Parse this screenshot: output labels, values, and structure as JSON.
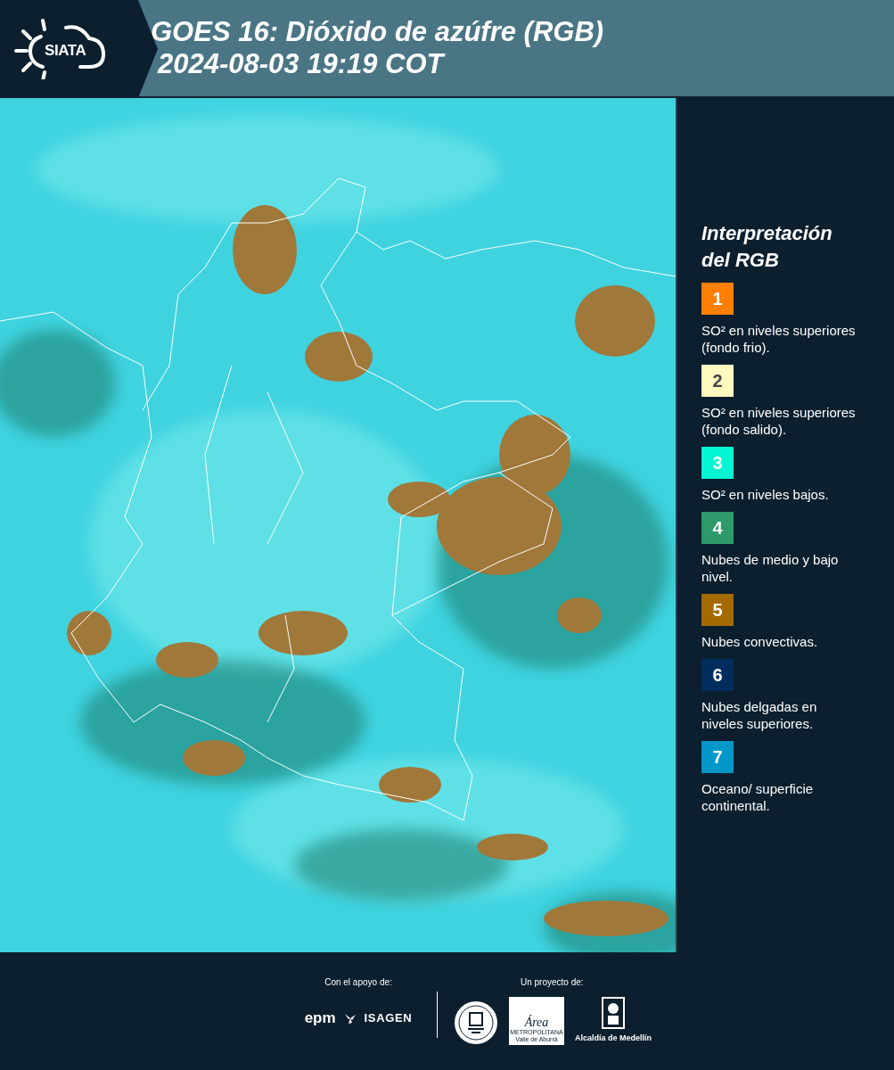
{
  "header": {
    "logo_text": "SIATA",
    "title_line_1": "GOES 16: Dióxido de azúfre (RGB)",
    "title_line_2": "2024-08-03 19:19 COT"
  },
  "legend": {
    "title_line_1": "Interpretación",
    "title_line_2": "del RGB",
    "items": [
      {
        "number": "1",
        "color": "#ff7f00",
        "text": "SO² en niveles superiores (fondo frio)."
      },
      {
        "number": "2",
        "color": "#fff9c0",
        "text": "SO² en niveles superiores (fondo salido)."
      },
      {
        "number": "3",
        "color": "#00f5d0",
        "text": "SO² en niveles bajos."
      },
      {
        "number": "4",
        "color": "#2e9a6a",
        "text": "Nubes de medio y bajo nivel."
      },
      {
        "number": "5",
        "color": "#a36a00",
        "text": "Nubes convectivas."
      },
      {
        "number": "6",
        "color": "#002d5e",
        "text": "Nubes delgadas en niveles superiores."
      },
      {
        "number": "7",
        "color": "#0098c8",
        "text": "Oceano/ superficie continental."
      }
    ]
  },
  "footer": {
    "support_label": "Con el apoyo de:",
    "project_label": "Un proyecto de:",
    "epm": "epm",
    "isagen": "ISAGEN",
    "area_title": "Área",
    "area_sub_1": "METROPOLITANA",
    "area_sub_2": "Valle de Aburrá",
    "alcaldia": "Alcaldía de Medellín"
  }
}
